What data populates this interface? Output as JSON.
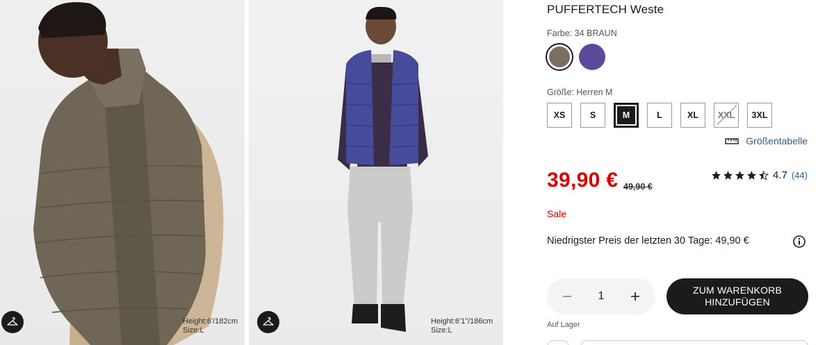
{
  "gallery": {
    "image1": {
      "alt": "Model in brauner PUFFERTECH Weste",
      "height": "Height:6'/182cm",
      "size": "Size:L"
    },
    "image2": {
      "alt": "Model in lila PUFFERTECH Weste",
      "height": "Height:6'1\"/186cm",
      "size": "Size:L"
    },
    "hanger_icon": "hanger-icon"
  },
  "product": {
    "title": "PUFFERTECH Weste",
    "color_label": "Farbe: 34 BRAUN",
    "colors": [
      {
        "name": "BRAUN",
        "hex": "#7d6e62",
        "selected": true
      },
      {
        "name": "LILA",
        "hex": "#5b4a9a",
        "selected": false
      }
    ],
    "size_label": "Größe: Herren M",
    "sizes": [
      {
        "label": "XS",
        "state": "available"
      },
      {
        "label": "S",
        "state": "available"
      },
      {
        "label": "M",
        "state": "selected"
      },
      {
        "label": "L",
        "state": "available"
      },
      {
        "label": "XL",
        "state": "available"
      },
      {
        "label": "XXL",
        "state": "unavailable"
      },
      {
        "label": "3XL",
        "state": "available"
      }
    ],
    "size_chart_label": "Größentabelle",
    "price": "39,90 €",
    "old_price": "49,90 €",
    "rating": {
      "stars": 4.5,
      "score": "4.7",
      "count": "(44)"
    },
    "sale_label": "Sale",
    "lowest_price": "Niedrigster Preis der letzten 30 Tage: 49,90 €",
    "quantity": "1",
    "add_to_cart": "ZUM WARENKORB HINZUFÜGEN",
    "stock": "Auf Lager"
  },
  "colors": {
    "price_red": "#d10000",
    "link_blue": "#2d5e8c",
    "sale_red": "#b60000"
  }
}
